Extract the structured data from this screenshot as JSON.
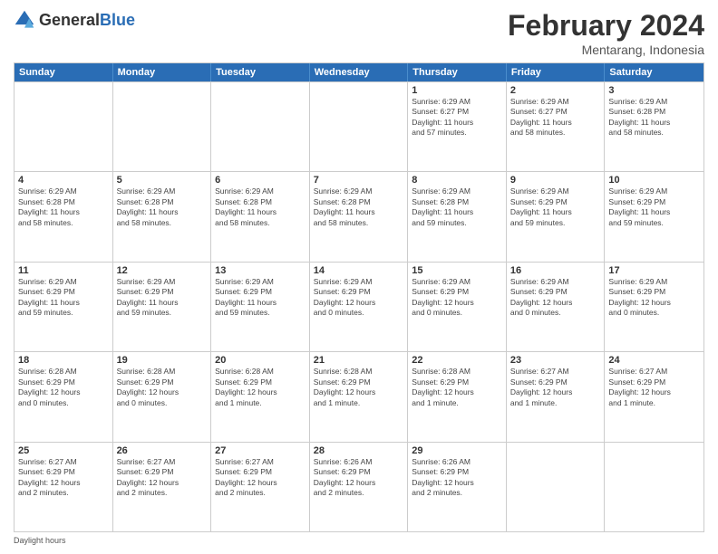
{
  "logo": {
    "general": "General",
    "blue": "Blue"
  },
  "header": {
    "month_year": "February 2024",
    "location": "Mentarang, Indonesia"
  },
  "days_of_week": [
    "Sunday",
    "Monday",
    "Tuesday",
    "Wednesday",
    "Thursday",
    "Friday",
    "Saturday"
  ],
  "weeks": [
    [
      {
        "day": "",
        "info": ""
      },
      {
        "day": "",
        "info": ""
      },
      {
        "day": "",
        "info": ""
      },
      {
        "day": "",
        "info": ""
      },
      {
        "day": "1",
        "info": "Sunrise: 6:29 AM\nSunset: 6:27 PM\nDaylight: 11 hours\nand 57 minutes."
      },
      {
        "day": "2",
        "info": "Sunrise: 6:29 AM\nSunset: 6:27 PM\nDaylight: 11 hours\nand 58 minutes."
      },
      {
        "day": "3",
        "info": "Sunrise: 6:29 AM\nSunset: 6:28 PM\nDaylight: 11 hours\nand 58 minutes."
      }
    ],
    [
      {
        "day": "4",
        "info": "Sunrise: 6:29 AM\nSunset: 6:28 PM\nDaylight: 11 hours\nand 58 minutes."
      },
      {
        "day": "5",
        "info": "Sunrise: 6:29 AM\nSunset: 6:28 PM\nDaylight: 11 hours\nand 58 minutes."
      },
      {
        "day": "6",
        "info": "Sunrise: 6:29 AM\nSunset: 6:28 PM\nDaylight: 11 hours\nand 58 minutes."
      },
      {
        "day": "7",
        "info": "Sunrise: 6:29 AM\nSunset: 6:28 PM\nDaylight: 11 hours\nand 58 minutes."
      },
      {
        "day": "8",
        "info": "Sunrise: 6:29 AM\nSunset: 6:28 PM\nDaylight: 11 hours\nand 59 minutes."
      },
      {
        "day": "9",
        "info": "Sunrise: 6:29 AM\nSunset: 6:29 PM\nDaylight: 11 hours\nand 59 minutes."
      },
      {
        "day": "10",
        "info": "Sunrise: 6:29 AM\nSunset: 6:29 PM\nDaylight: 11 hours\nand 59 minutes."
      }
    ],
    [
      {
        "day": "11",
        "info": "Sunrise: 6:29 AM\nSunset: 6:29 PM\nDaylight: 11 hours\nand 59 minutes."
      },
      {
        "day": "12",
        "info": "Sunrise: 6:29 AM\nSunset: 6:29 PM\nDaylight: 11 hours\nand 59 minutes."
      },
      {
        "day": "13",
        "info": "Sunrise: 6:29 AM\nSunset: 6:29 PM\nDaylight: 11 hours\nand 59 minutes."
      },
      {
        "day": "14",
        "info": "Sunrise: 6:29 AM\nSunset: 6:29 PM\nDaylight: 12 hours\nand 0 minutes."
      },
      {
        "day": "15",
        "info": "Sunrise: 6:29 AM\nSunset: 6:29 PM\nDaylight: 12 hours\nand 0 minutes."
      },
      {
        "day": "16",
        "info": "Sunrise: 6:29 AM\nSunset: 6:29 PM\nDaylight: 12 hours\nand 0 minutes."
      },
      {
        "day": "17",
        "info": "Sunrise: 6:29 AM\nSunset: 6:29 PM\nDaylight: 12 hours\nand 0 minutes."
      }
    ],
    [
      {
        "day": "18",
        "info": "Sunrise: 6:28 AM\nSunset: 6:29 PM\nDaylight: 12 hours\nand 0 minutes."
      },
      {
        "day": "19",
        "info": "Sunrise: 6:28 AM\nSunset: 6:29 PM\nDaylight: 12 hours\nand 0 minutes."
      },
      {
        "day": "20",
        "info": "Sunrise: 6:28 AM\nSunset: 6:29 PM\nDaylight: 12 hours\nand 1 minute."
      },
      {
        "day": "21",
        "info": "Sunrise: 6:28 AM\nSunset: 6:29 PM\nDaylight: 12 hours\nand 1 minute."
      },
      {
        "day": "22",
        "info": "Sunrise: 6:28 AM\nSunset: 6:29 PM\nDaylight: 12 hours\nand 1 minute."
      },
      {
        "day": "23",
        "info": "Sunrise: 6:27 AM\nSunset: 6:29 PM\nDaylight: 12 hours\nand 1 minute."
      },
      {
        "day": "24",
        "info": "Sunrise: 6:27 AM\nSunset: 6:29 PM\nDaylight: 12 hours\nand 1 minute."
      }
    ],
    [
      {
        "day": "25",
        "info": "Sunrise: 6:27 AM\nSunset: 6:29 PM\nDaylight: 12 hours\nand 2 minutes."
      },
      {
        "day": "26",
        "info": "Sunrise: 6:27 AM\nSunset: 6:29 PM\nDaylight: 12 hours\nand 2 minutes."
      },
      {
        "day": "27",
        "info": "Sunrise: 6:27 AM\nSunset: 6:29 PM\nDaylight: 12 hours\nand 2 minutes."
      },
      {
        "day": "28",
        "info": "Sunrise: 6:26 AM\nSunset: 6:29 PM\nDaylight: 12 hours\nand 2 minutes."
      },
      {
        "day": "29",
        "info": "Sunrise: 6:26 AM\nSunset: 6:29 PM\nDaylight: 12 hours\nand 2 minutes."
      },
      {
        "day": "",
        "info": ""
      },
      {
        "day": "",
        "info": ""
      }
    ]
  ],
  "footer": {
    "text": "Daylight hours"
  }
}
